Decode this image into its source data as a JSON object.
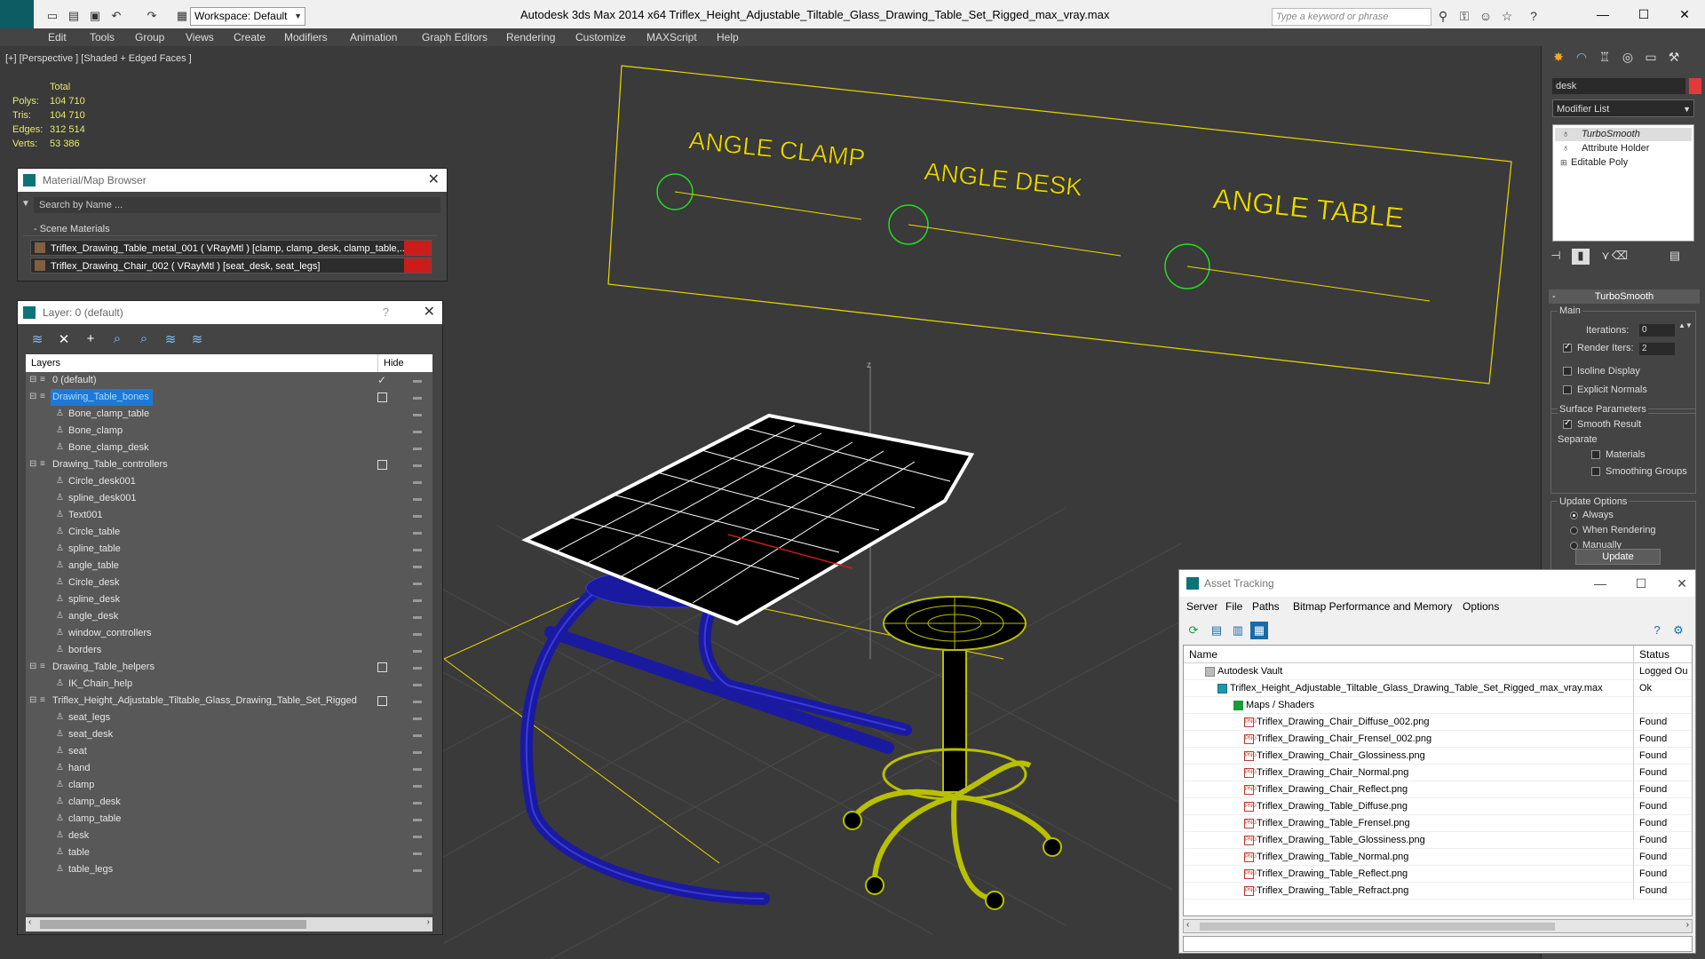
{
  "titlebar": {
    "workspace": "Workspace: Default",
    "title": "Autodesk 3ds Max  2014 x64      Triflex_Height_Adjustable_Tiltable_Glass_Drawing_Table_Set_Rigged_max_vray.max",
    "search_placeholder": "Type a keyword or phrase"
  },
  "menu": [
    "Edit",
    "Tools",
    "Group",
    "Views",
    "Create",
    "Modifiers",
    "Animation",
    "Graph Editors",
    "Rendering",
    "Customize",
    "MAXScript",
    "Help"
  ],
  "viewport": {
    "label": "[+] [Perspective ] [Shaded + Edged Faces ]",
    "stats": {
      "total_label": "Total",
      "polys_label": "Polys:",
      "polys": "104 710",
      "tris_label": "Tris:",
      "tris": "104 710",
      "edges_label": "Edges:",
      "edges": "312 514",
      "verts_label": "Verts:",
      "verts": "53 386"
    },
    "scene_labels": [
      "ANGLE CLAMP",
      "ANGLE DESK",
      "ANGLE TABLE"
    ],
    "axis_label": "z"
  },
  "material_browser": {
    "title": "Material/Map Browser",
    "search_placeholder": "Search by Name ...",
    "section": "- Scene Materials",
    "materials": [
      "Triflex_Drawing_Table_metal_001  ( VRayMtl )  [clamp, clamp_desk, clamp_table,...",
      "Triflex_Drawing_Chair_002  ( VRayMtl )  [seat_desk, seat_legs]"
    ]
  },
  "layer_panel": {
    "title": "Layer: 0 (default)",
    "help": "?",
    "col_layers": "Layers",
    "col_hide": "Hide",
    "rows": [
      {
        "name": "0 (default)",
        "level": 0,
        "type": "layer",
        "hide": "check"
      },
      {
        "name": "Drawing_Table_bones",
        "level": 0,
        "type": "layer",
        "hide": "box",
        "selected": true
      },
      {
        "name": "Bone_clamp_table",
        "level": 1,
        "type": "obj"
      },
      {
        "name": "Bone_clamp",
        "level": 1,
        "type": "obj"
      },
      {
        "name": "Bone_clamp_desk",
        "level": 1,
        "type": "obj"
      },
      {
        "name": "Drawing_Table_controllers",
        "level": 0,
        "type": "layer",
        "hide": "box"
      },
      {
        "name": "Circle_desk001",
        "level": 1,
        "type": "obj"
      },
      {
        "name": "spline_desk001",
        "level": 1,
        "type": "obj"
      },
      {
        "name": "Text001",
        "level": 1,
        "type": "obj"
      },
      {
        "name": "Circle_table",
        "level": 1,
        "type": "obj"
      },
      {
        "name": "spline_table",
        "level": 1,
        "type": "obj"
      },
      {
        "name": "angle_table",
        "level": 1,
        "type": "obj"
      },
      {
        "name": "Circle_desk",
        "level": 1,
        "type": "obj"
      },
      {
        "name": "spline_desk",
        "level": 1,
        "type": "obj"
      },
      {
        "name": "angle_desk",
        "level": 1,
        "type": "obj"
      },
      {
        "name": "window_controllers",
        "level": 1,
        "type": "obj"
      },
      {
        "name": "borders",
        "level": 1,
        "type": "obj"
      },
      {
        "name": "Drawing_Table_helpers",
        "level": 0,
        "type": "layer",
        "hide": "box"
      },
      {
        "name": "IK_Chain_help",
        "level": 1,
        "type": "obj"
      },
      {
        "name": "Triflex_Height_Adjustable_Tiltable_Glass_Drawing_Table_Set_Rigged",
        "level": 0,
        "type": "layer",
        "hide": "box"
      },
      {
        "name": "seat_legs",
        "level": 1,
        "type": "obj"
      },
      {
        "name": "seat_desk",
        "level": 1,
        "type": "obj"
      },
      {
        "name": "seat",
        "level": 1,
        "type": "obj"
      },
      {
        "name": "hand",
        "level": 1,
        "type": "obj"
      },
      {
        "name": "clamp",
        "level": 1,
        "type": "obj"
      },
      {
        "name": "clamp_desk",
        "level": 1,
        "type": "obj"
      },
      {
        "name": "clamp_table",
        "level": 1,
        "type": "obj"
      },
      {
        "name": "desk",
        "level": 1,
        "type": "obj"
      },
      {
        "name": "table",
        "level": 1,
        "type": "obj"
      },
      {
        "name": "table_legs",
        "level": 1,
        "type": "obj"
      }
    ]
  },
  "command_panel": {
    "object_name": "desk",
    "modifier_list": "Modifier List",
    "stack": [
      "TurboSmooth",
      "Attribute Holder",
      "Editable Poly"
    ],
    "rollout_title": "TurboSmooth",
    "main_label": "Main",
    "iterations_label": "Iterations:",
    "iterations": "0",
    "render_iters_label": "Render Iters:",
    "render_iters": "2",
    "isoline": "Isoline Display",
    "explicit": "Explicit Normals",
    "surface_params": "Surface Parameters",
    "smooth_result": "Smooth Result",
    "separate": "Separate",
    "materials": "Materials",
    "smoothing_groups": "Smoothing Groups",
    "update_options": "Update Options",
    "always": "Always",
    "when_rendering": "When Rendering",
    "manually": "Manually",
    "update": "Update"
  },
  "asset_tracking": {
    "title": "Asset Tracking",
    "menu": [
      "Server",
      "File",
      "Paths",
      "Bitmap Performance and Memory",
      "Options"
    ],
    "col_name": "Name",
    "col_status": "Status",
    "rows": [
      {
        "name": "Autodesk Vault",
        "status": "Logged Ou",
        "level": 0,
        "icon": "vault"
      },
      {
        "name": "Triflex_Height_Adjustable_Tiltable_Glass_Drawing_Table_Set_Rigged_max_vray.max",
        "status": "Ok",
        "level": 1,
        "icon": "max"
      },
      {
        "name": "Maps / Shaders",
        "status": "",
        "level": 2,
        "icon": "maps"
      },
      {
        "name": "Triflex_Drawing_Chair_Diffuse_002.png",
        "status": "Found",
        "level": 3,
        "icon": "png"
      },
      {
        "name": "Triflex_Drawing_Chair_Frensel_002.png",
        "status": "Found",
        "level": 3,
        "icon": "png"
      },
      {
        "name": "Triflex_Drawing_Chair_Glossiness.png",
        "status": "Found",
        "level": 3,
        "icon": "png"
      },
      {
        "name": "Triflex_Drawing_Chair_Normal.png",
        "status": "Found",
        "level": 3,
        "icon": "png"
      },
      {
        "name": "Triflex_Drawing_Chair_Reflect.png",
        "status": "Found",
        "level": 3,
        "icon": "png"
      },
      {
        "name": "Triflex_Drawing_Table_Diffuse.png",
        "status": "Found",
        "level": 3,
        "icon": "png"
      },
      {
        "name": "Triflex_Drawing_Table_Frensel.png",
        "status": "Found",
        "level": 3,
        "icon": "png"
      },
      {
        "name": "Triflex_Drawing_Table_Glossiness.png",
        "status": "Found",
        "level": 3,
        "icon": "png"
      },
      {
        "name": "Triflex_Drawing_Table_Normal.png",
        "status": "Found",
        "level": 3,
        "icon": "png"
      },
      {
        "name": "Triflex_Drawing_Table_Reflect.png",
        "status": "Found",
        "level": 3,
        "icon": "png"
      },
      {
        "name": "Triflex_Drawing_Table_Refract.png",
        "status": "Found",
        "level": 3,
        "icon": "png"
      }
    ]
  },
  "colors": {
    "accent": "#1e78d6",
    "stats_yellow": "#e8e874",
    "spline_yellow": "#e8d800",
    "controller_green": "#22dd22",
    "table_blue": "#1a1aa0",
    "chair_yellow": "#b8c000",
    "material_red": "#cc1b1b"
  }
}
